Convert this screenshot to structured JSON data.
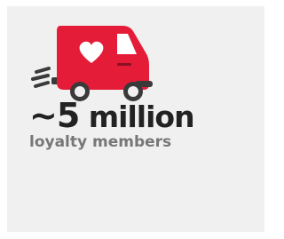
{
  "stat": {
    "value": "~5",
    "unit": " million",
    "label": "loyalty members"
  },
  "icon": {
    "name": "delivery-van-heart-icon",
    "body_color": "#e41c38",
    "accent_color": "#ffffff",
    "wheel_color": "#3a3a3a"
  },
  "colors": {
    "card_background": "#f0f0f0",
    "stat_text": "#222222",
    "label_text": "#777777"
  }
}
